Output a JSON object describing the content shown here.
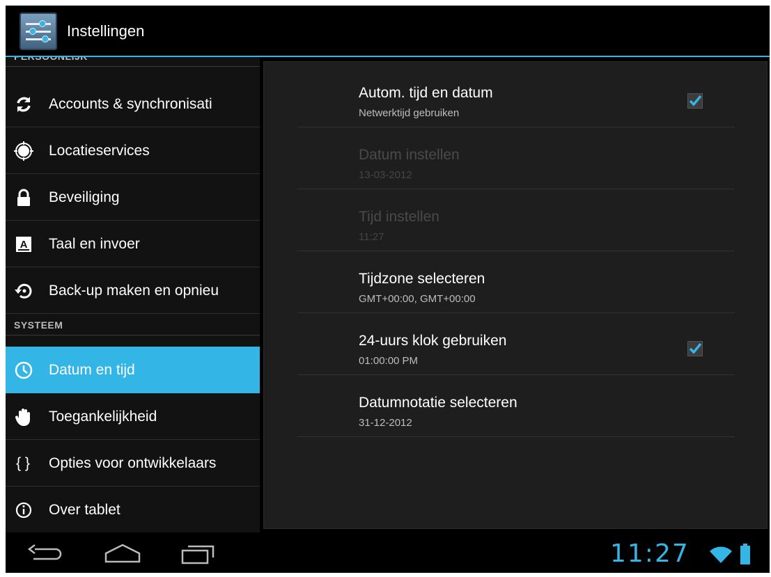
{
  "app": {
    "title": "Instellingen",
    "icon": "settings-sliders-icon"
  },
  "sidebar": {
    "partial_header": "PERSOONLIJK",
    "items_personal": [
      {
        "label": "Accounts & synchronisati",
        "icon": "sync-icon"
      },
      {
        "label": "Locatieservices",
        "icon": "location-icon"
      },
      {
        "label": "Beveiliging",
        "icon": "lock-icon"
      },
      {
        "label": "Taal en invoer",
        "icon": "keyboard-a-icon"
      },
      {
        "label": "Back-up maken en opnieu",
        "icon": "restore-icon"
      }
    ],
    "system_header": "SYSTEEM",
    "items_system": [
      {
        "label": "Datum en tijd",
        "icon": "clock-icon",
        "selected": true
      },
      {
        "label": "Toegankelijkheid",
        "icon": "hand-icon"
      },
      {
        "label": "Opties voor ontwikkelaars",
        "icon": "braces-icon",
        "glyph": "{ }"
      },
      {
        "label": "Over tablet",
        "icon": "info-icon"
      }
    ]
  },
  "detail": {
    "rows": [
      {
        "title": "Autom. tijd en datum",
        "subtitle": "Netwerktijd gebruiken",
        "checkbox": true,
        "checked": true,
        "enabled": true
      },
      {
        "title": "Datum instellen",
        "subtitle": "13-03-2012",
        "checkbox": false,
        "enabled": false
      },
      {
        "title": "Tijd instellen",
        "subtitle": "11:27",
        "checkbox": false,
        "enabled": false
      },
      {
        "title": "Tijdzone selecteren",
        "subtitle": "GMT+00:00, GMT+00:00",
        "checkbox": false,
        "enabled": true
      },
      {
        "title": "24-uurs klok gebruiken",
        "subtitle": "01:00:00 PM",
        "checkbox": true,
        "checked": true,
        "enabled": true
      },
      {
        "title": "Datumnotatie selecteren",
        "subtitle": "31-12-2012",
        "checkbox": false,
        "enabled": true
      }
    ]
  },
  "statusbar": {
    "time": "11:27",
    "icons": [
      "wifi-icon",
      "battery-icon"
    ]
  },
  "navbar": {
    "buttons": [
      "back-icon",
      "home-icon",
      "recent-apps-icon"
    ]
  },
  "colors": {
    "accent": "#33b5e5",
    "background": "#000000",
    "panel": "#1e1e1e",
    "sidebar": "#121212"
  }
}
